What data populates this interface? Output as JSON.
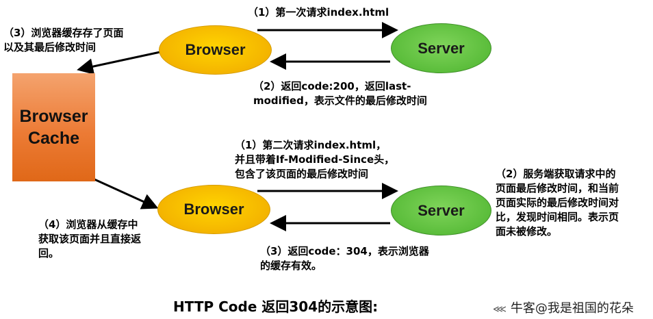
{
  "nodes": {
    "browser_top": "Browser",
    "server_top": "Server",
    "browser_bottom": "Browser",
    "server_bottom": "Server",
    "cache": "Browser\nCache"
  },
  "labels": {
    "first_request": "（1）第一次请求index.html",
    "first_response": "（2）返回code:200，返回last-\nmodified，表示文件的最后修改时间",
    "cache_store": "（3）浏览器缓存存了页面\n以及其最后修改时间",
    "second_request": "（1）第二次请求index.html，\n并且带着If-Modified-Since头，\n包含了该页面的最后修改时间",
    "server_check": "（2）服务端获取请求中的\n页面最后修改时间，和当前\n页面实际的最后修改时间对\n比，发现时间相同。表示页\n面未被修改。",
    "second_response": "（3）返回code：304，表示浏览器\n的缓存有效。",
    "cache_fetch": "（4）浏览器从缓存中\n获取该页面并且直接返\n回。"
  },
  "footer": {
    "title": "HTTP Code 返回304的示意图:",
    "watermark": "牛客@我是祖国的花朵"
  }
}
